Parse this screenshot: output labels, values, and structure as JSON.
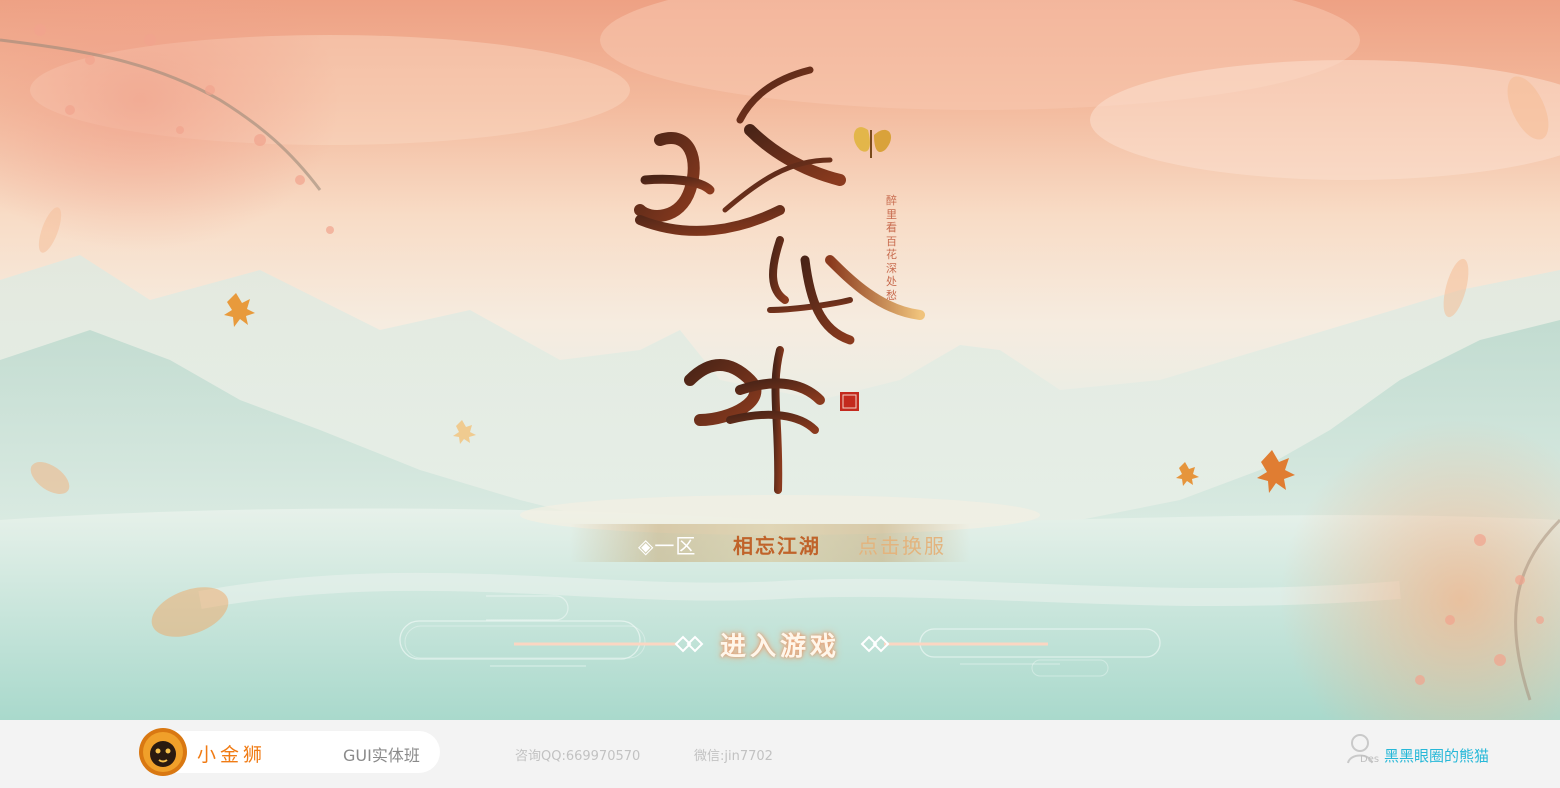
{
  "game": {
    "logo_text": "吟风醉",
    "slogan": "醉里看百花深处愁"
  },
  "server": {
    "zone": "◈一区",
    "name": "相忘江湖",
    "switch_label": "点击换服"
  },
  "enter_button": {
    "label": "进入游戏"
  },
  "footer": {
    "brand_name": "小金狮",
    "course": "GUI实体班",
    "qq": "咨询QQ:669970570",
    "wechat": "微信:jin7702",
    "author_tag": "Des",
    "author": "黑黑眼圈的熊猫"
  },
  "colors": {
    "sky_top": "#eea184",
    "accent_orange": "#f07b14",
    "server_name": "#c0632a",
    "author_link": "#27b8d8"
  },
  "icons": [
    "lion-logo-icon",
    "user-icon",
    "butterfly-icon",
    "seal-icon",
    "maple-leaf-icon"
  ]
}
